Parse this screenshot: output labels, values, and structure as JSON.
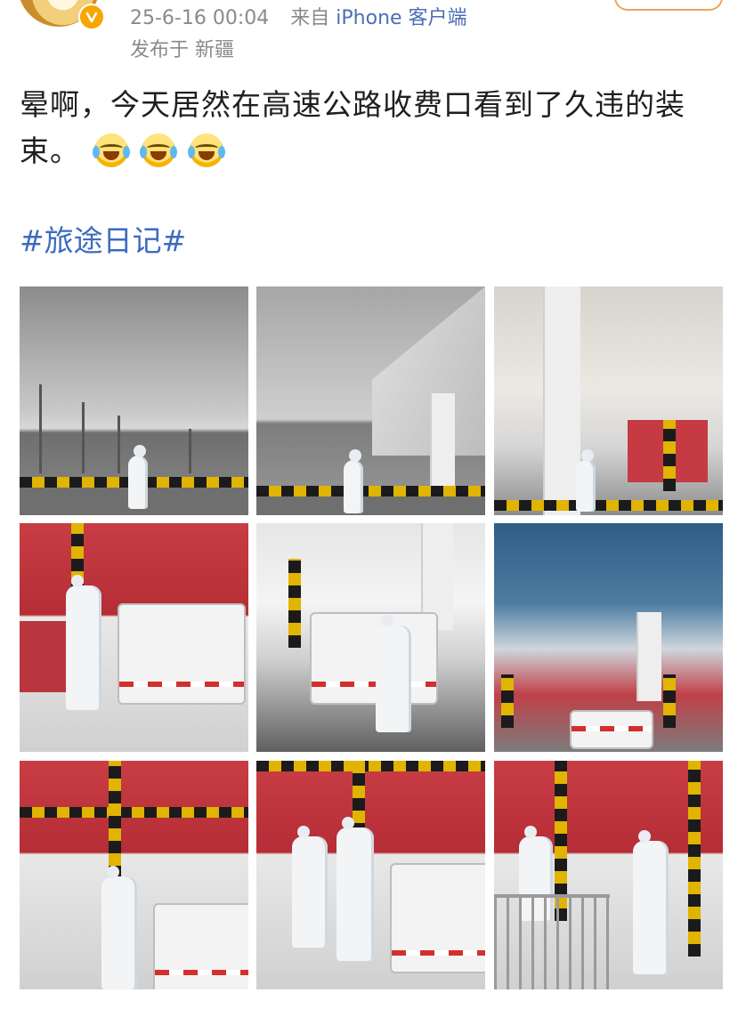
{
  "post": {
    "timestamp": "25-6-16 00:04",
    "source_prefix": "来自",
    "source_device": "iPhone 客户端",
    "location": "发布于 新疆",
    "text": "晕啊，今天居然在高速公路收费口看到了久违的装束。",
    "emojis": [
      "laugh-cry-emoji",
      "laugh-cry-emoji",
      "laugh-cry-emoji"
    ],
    "topic": "#旅途日记#"
  },
  "colors": {
    "meta_gray": "#8a8a8a",
    "link_blue": "#3d6bc0",
    "verified_badge": "#f7a500"
  },
  "photos": [
    {
      "scene": "toll-plaza-road-worker"
    },
    {
      "scene": "toll-plaza-arches-worker"
    },
    {
      "scene": "toll-canopy-pillar-worker"
    },
    {
      "scene": "worker-beside-truck"
    },
    {
      "scene": "worker-behind-truck"
    },
    {
      "scene": "toll-canopy-blue-sky"
    },
    {
      "scene": "booth-worker-and-truck"
    },
    {
      "scene": "two-workers-at-booth"
    },
    {
      "scene": "workers-at-booth-railing"
    }
  ]
}
